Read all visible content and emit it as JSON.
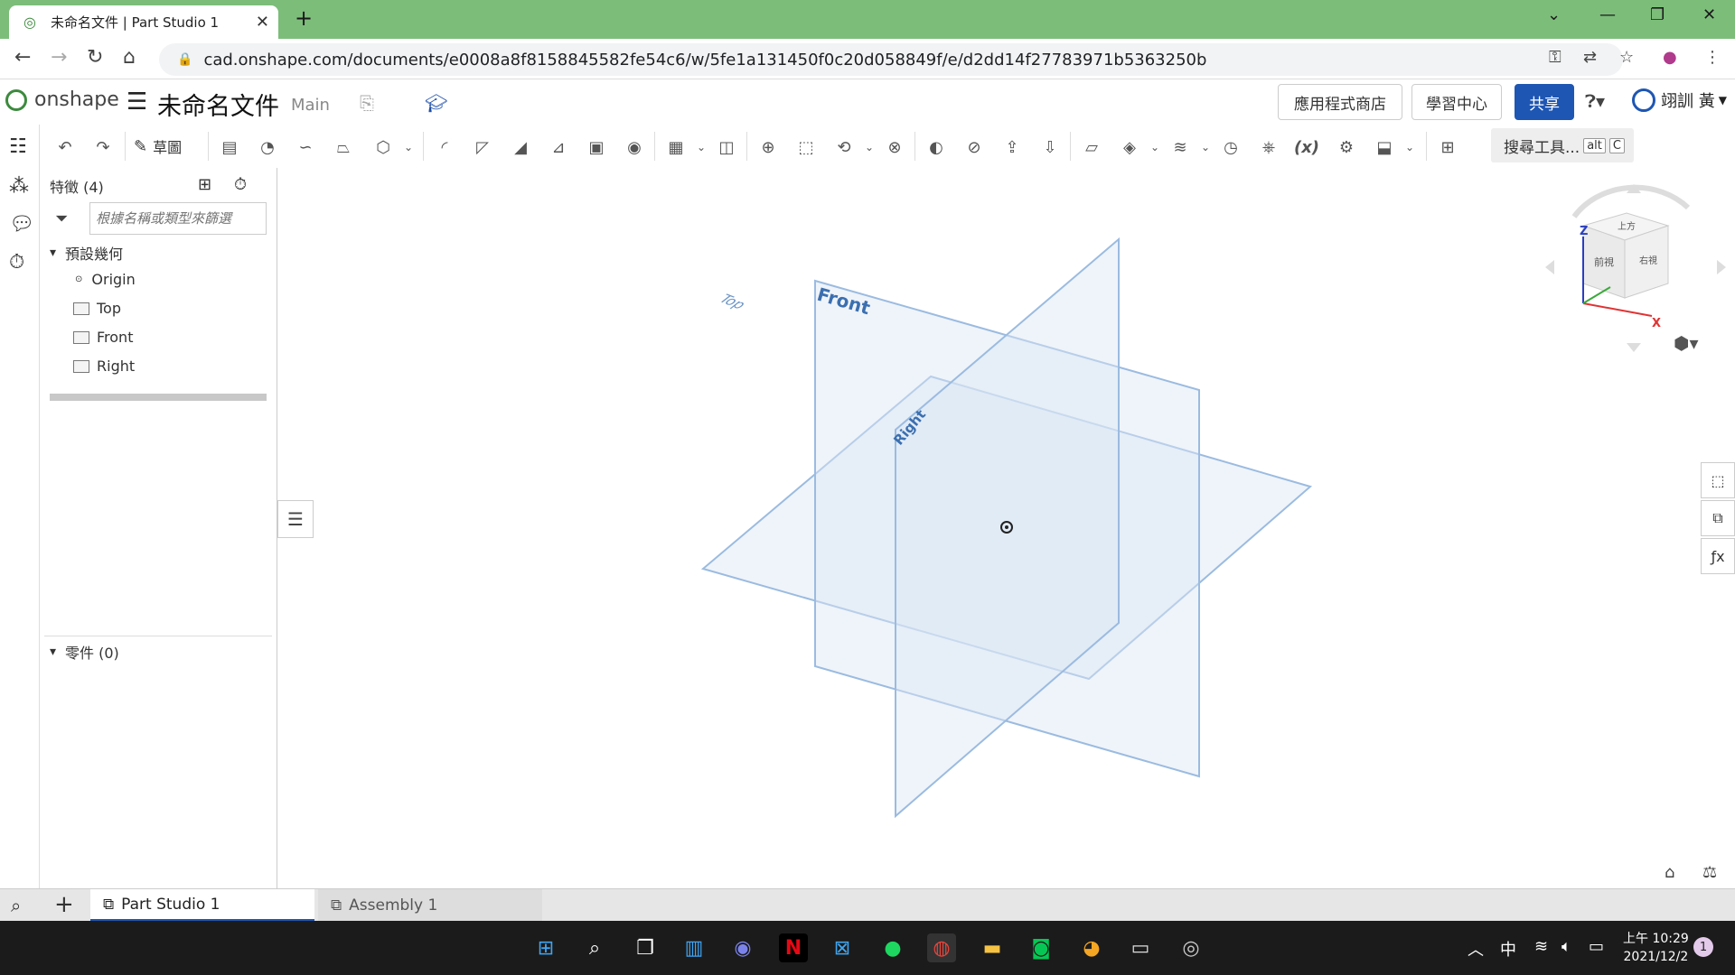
{
  "browser": {
    "tab_title": "未命名文件 | Part Studio 1",
    "url": "cad.onshape.com/documents/e0008a8f8158845582fe54c6/w/5fe1a131450f0c20d058849f/e/d2dd14f27783971b5363250b"
  },
  "header": {
    "logo_text": "onshape",
    "doc_name": "未命名文件",
    "branch": "Main",
    "app_store": "應用程式商店",
    "learning_center": "學習中心",
    "share": "共享",
    "user_name": "翊訓 黃"
  },
  "toolbar": {
    "sketch_label": "草圖",
    "search_label": "搜尋工具...",
    "search_kbd_1": "alt",
    "search_kbd_2": "C",
    "fx_label": "(x)"
  },
  "feature_panel": {
    "header": "特徵 (4)",
    "filter_placeholder": "根據名稱或類型來篩選",
    "default_geometry": "預設幾何",
    "items": [
      "Origin",
      "Top",
      "Front",
      "Right"
    ],
    "parts_header": "零件 (0)"
  },
  "viewport": {
    "plane_labels": {
      "front": "Front",
      "top": "Top",
      "right": "Right"
    },
    "plane_color": "#8fb3d9"
  },
  "viewcube": {
    "z_label": "Z",
    "x_label": "X",
    "top_face": "上方",
    "front_face": "前視",
    "right_face": "右視"
  },
  "bottom_tabs": [
    {
      "label": "Part Studio 1",
      "active": true
    },
    {
      "label": "Assembly 1",
      "active": false
    }
  ],
  "taskbar": {
    "time": "上午 10:29",
    "date": "2021/12/2",
    "ime": "中",
    "notifications": "1"
  }
}
